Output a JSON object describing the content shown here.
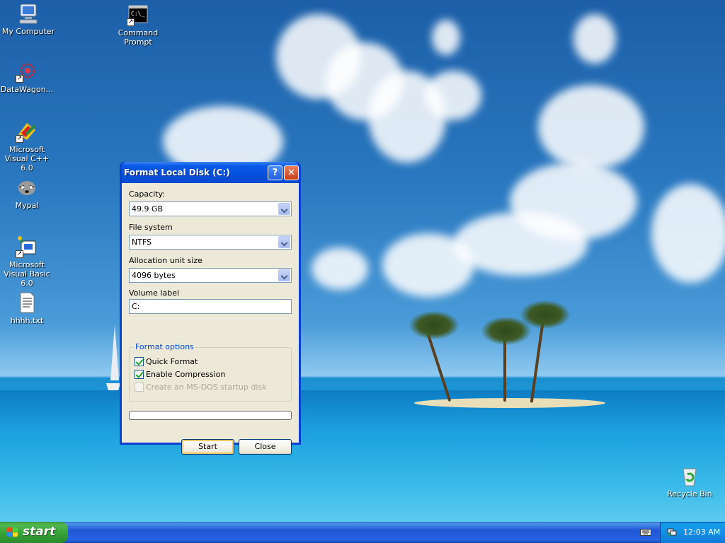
{
  "desktop": {
    "icons": [
      {
        "label": "My Computer",
        "icon": "my-computer-icon"
      },
      {
        "label": "Command Prompt",
        "icon": "command-prompt-icon"
      },
      {
        "label": "DataWagon...",
        "icon": "datawagon-icon"
      },
      {
        "label": "Microsoft Visual C++ 6.0",
        "icon": "visual-cpp-icon"
      },
      {
        "label": "Mypal",
        "icon": "mypal-raccoon-icon"
      },
      {
        "label": "Microsoft Visual Basic 6.0",
        "icon": "visual-basic-icon"
      },
      {
        "label": "hhhh.txt",
        "icon": "text-file-icon"
      },
      {
        "label": "Recycle Bin",
        "icon": "recycle-bin-icon"
      }
    ]
  },
  "dialog": {
    "title": "Format Local Disk (C:)",
    "help_glyph": "?",
    "close_glyph": "✕",
    "capacity_label": "Capacity:",
    "capacity_value": "49.9 GB",
    "filesystem_label": "File system",
    "filesystem_value": "NTFS",
    "allocation_label": "Allocation unit size",
    "allocation_value": "4096 bytes",
    "volume_label_label": "Volume label",
    "volume_label_value": "C:",
    "format_options_title": "Format options",
    "options": {
      "quick_format": {
        "label": "Quick Format",
        "checked": true
      },
      "enable_compression": {
        "label": "Enable Compression",
        "checked": true
      },
      "msdos_startup": {
        "label": "Create an MS-DOS startup disk",
        "checked": false,
        "enabled": false
      }
    },
    "progress": 0,
    "start_label": "Start",
    "close_label": "Close"
  },
  "taskbar": {
    "start_label": "start",
    "clock": "12:03 AM"
  },
  "colors": {
    "title_blue": "#0450dc",
    "start_green": "#36a236",
    "taskbar_blue": "#2157d7",
    "tray_blue": "#1290e8",
    "dialog_face": "#ece9d8",
    "group_title": "#0046d5",
    "check_green": "#21a121"
  }
}
